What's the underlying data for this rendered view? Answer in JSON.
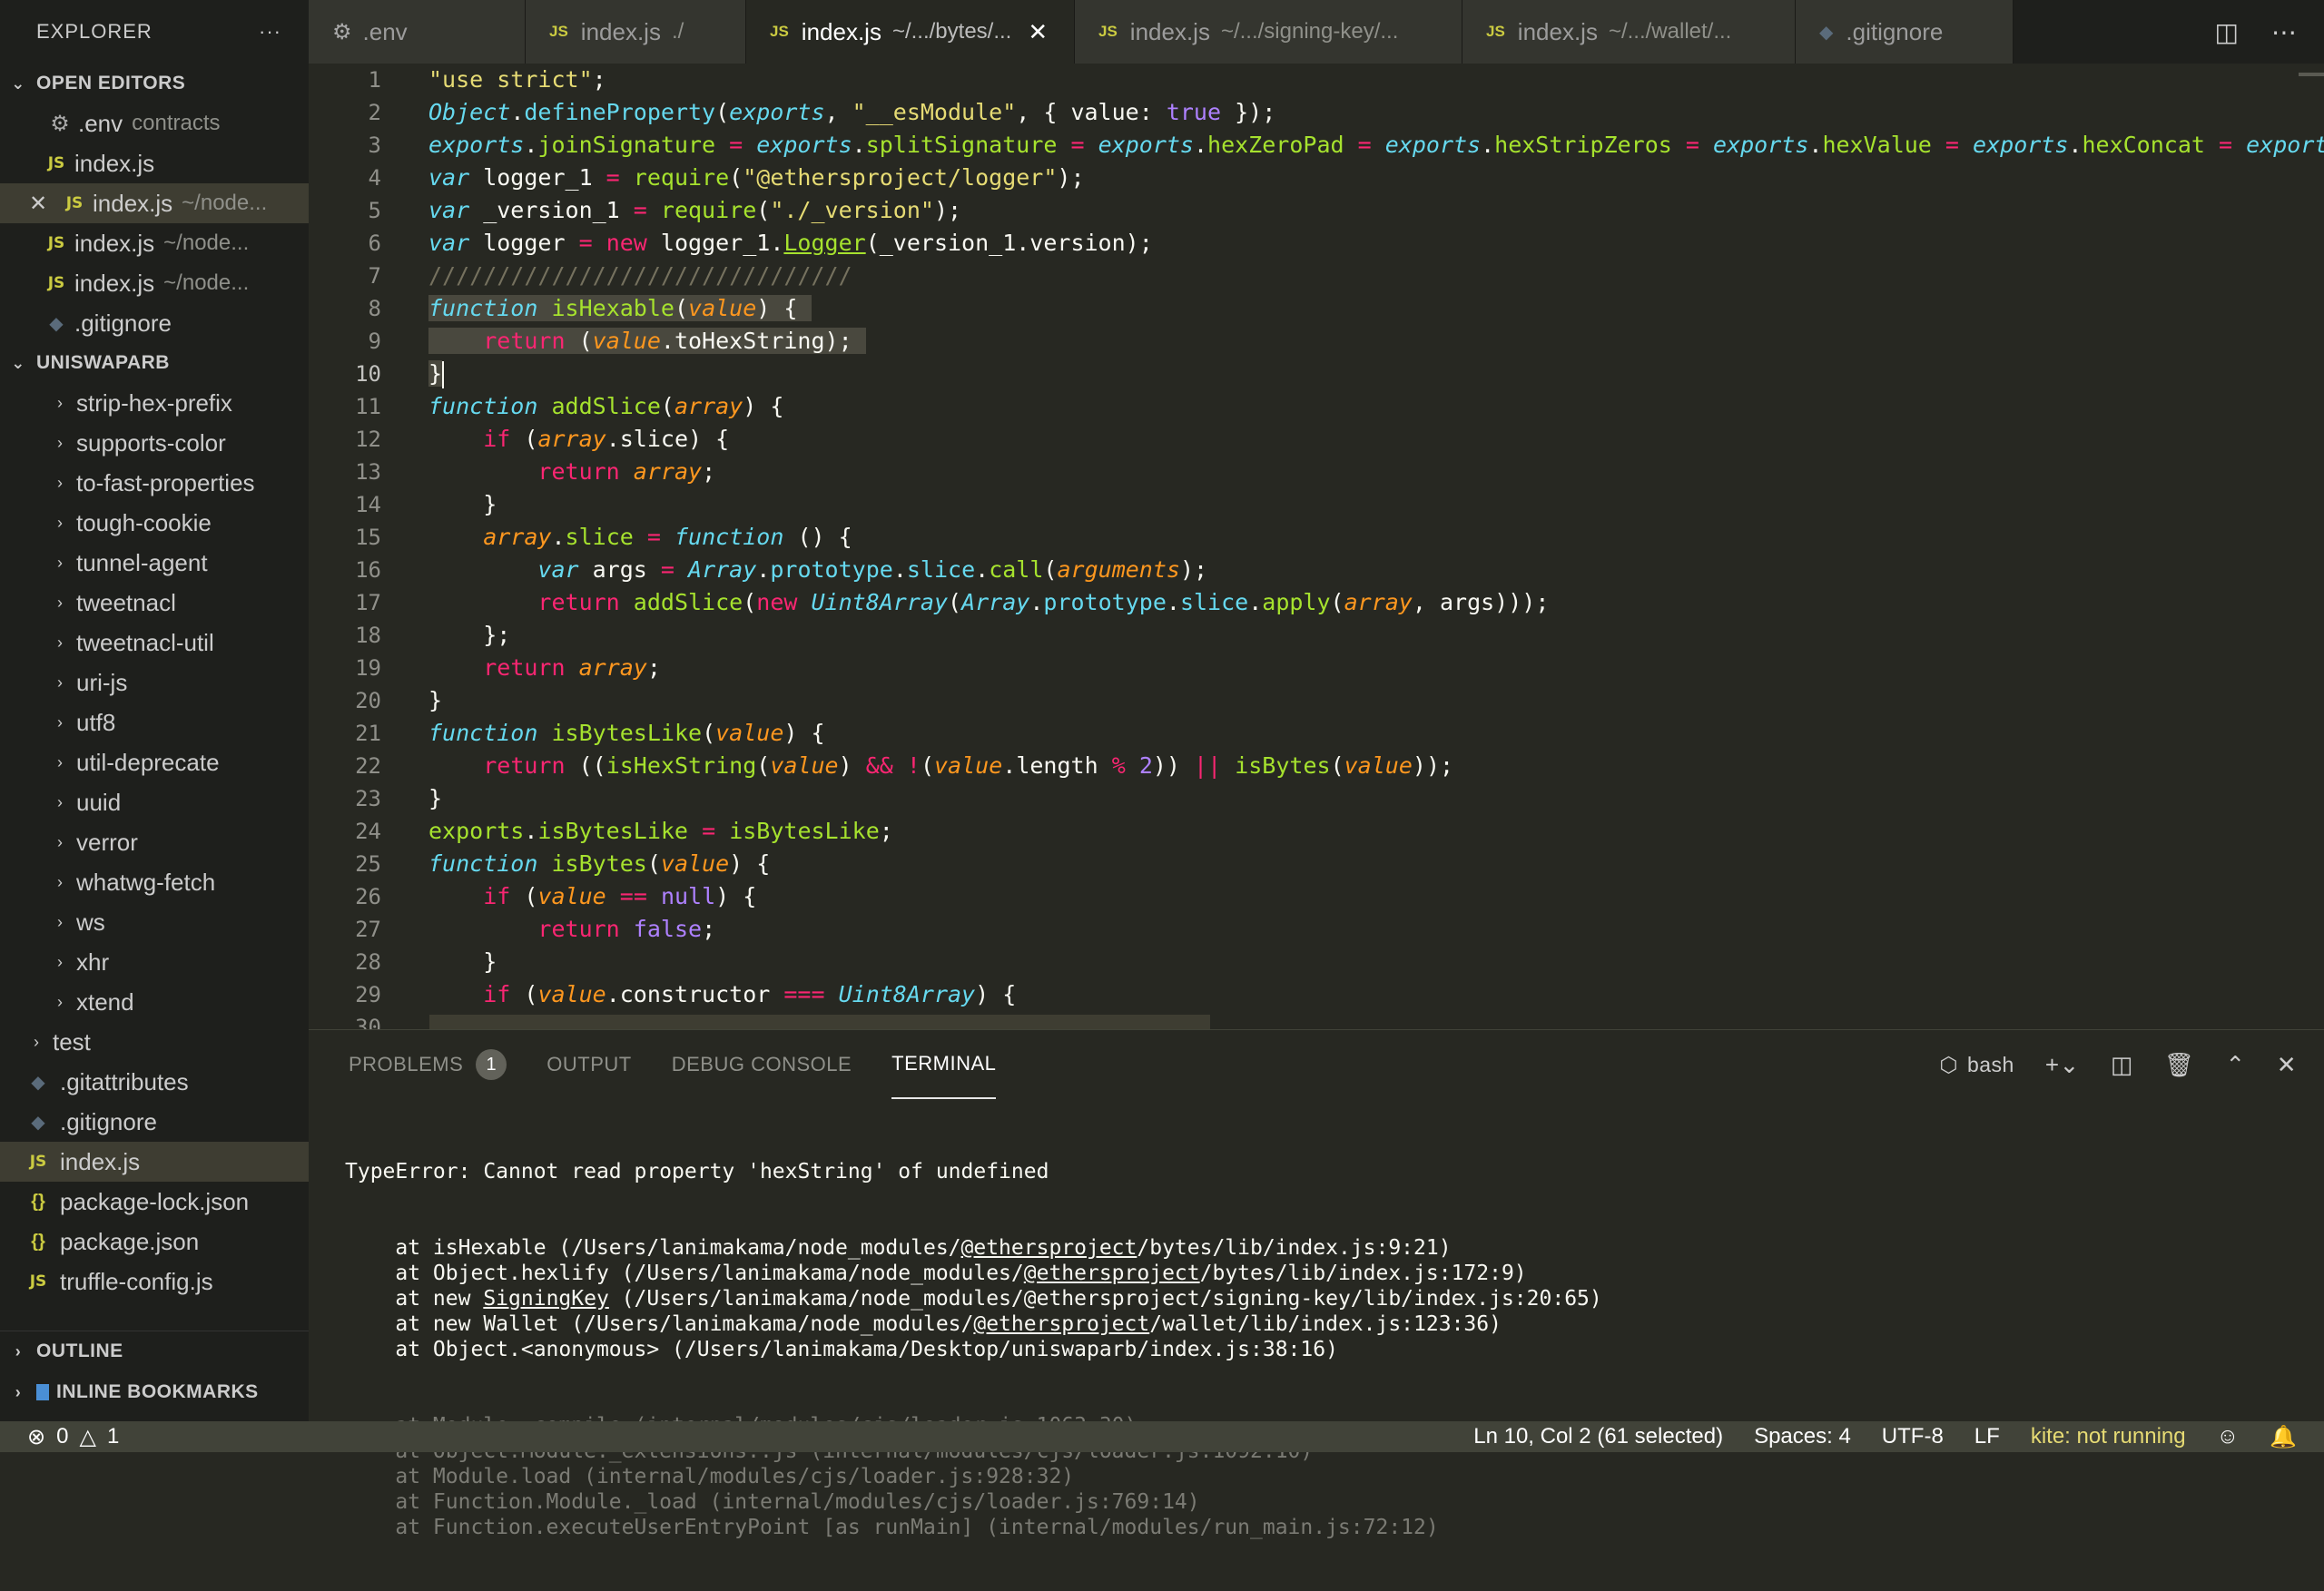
{
  "sidebar": {
    "title": "EXPLORER",
    "more": "···",
    "open_editors_label": "OPEN EDITORS",
    "open_editors": [
      {
        "name": ".env",
        "desc": "contracts",
        "icon": "gear-icon"
      },
      {
        "name": "index.js",
        "desc": "",
        "icon": "js-icon"
      },
      {
        "name": "index.js",
        "desc": "~/node...",
        "icon": "js-icon",
        "active": true
      },
      {
        "name": "index.js",
        "desc": "~/node...",
        "icon": "js-icon"
      },
      {
        "name": "index.js",
        "desc": "~/node...",
        "icon": "js-icon"
      },
      {
        "name": ".gitignore",
        "desc": "",
        "icon": "git-icon"
      }
    ],
    "project_label": "UNISWAPARB",
    "folders": [
      "strip-hex-prefix",
      "supports-color",
      "to-fast-properties",
      "tough-cookie",
      "tunnel-agent",
      "tweetnacl",
      "tweetnacl-util",
      "uri-js",
      "utf8",
      "util-deprecate",
      "uuid",
      "verror",
      "whatwg-fetch",
      "ws",
      "xhr",
      "xtend"
    ],
    "root_items": [
      {
        "name": "test",
        "type": "folder"
      },
      {
        "name": ".gitattributes",
        "type": "git"
      },
      {
        "name": ".gitignore",
        "type": "git"
      },
      {
        "name": "index.js",
        "type": "js",
        "active": true
      },
      {
        "name": "package-lock.json",
        "type": "json"
      },
      {
        "name": "package.json",
        "type": "json"
      },
      {
        "name": "truffle-config.js",
        "type": "js"
      }
    ],
    "outline_label": "OUTLINE",
    "bookmarks_label": "INLINE BOOKMARKS"
  },
  "tabs": [
    {
      "name": ".env",
      "desc": "",
      "icon": "gear"
    },
    {
      "name": "index.js",
      "desc": "./",
      "icon": "js"
    },
    {
      "name": "index.js",
      "desc": "~/.../bytes/...",
      "icon": "js",
      "active": true
    },
    {
      "name": "index.js",
      "desc": "~/.../signing-key/...",
      "icon": "js"
    },
    {
      "name": "index.js",
      "desc": "~/.../wallet/...",
      "icon": "js"
    },
    {
      "name": ".gitignore",
      "desc": "",
      "icon": "git"
    }
  ],
  "editor": {
    "line_numbers": [
      "1",
      "2",
      "3",
      "4",
      "5",
      "6",
      "7",
      "8",
      "9",
      "10",
      "11",
      "12",
      "13",
      "14",
      "15",
      "16",
      "17",
      "18",
      "19",
      "20",
      "21",
      "22",
      "23",
      "24",
      "25",
      "26",
      "27",
      "28",
      "29",
      "30"
    ],
    "current_line": "10"
  },
  "panel": {
    "tabs": [
      "PROBLEMS",
      "OUTPUT",
      "DEBUG CONSOLE",
      "TERMINAL"
    ],
    "problems_count": "1",
    "shell": "bash",
    "terminal": {
      "error": "TypeError: Cannot read property 'hexString' of undefined",
      "trace": [
        {
          "pre": "    at isHexable (/Users/lanimakama/node_modules/",
          "link": "@ethersproject",
          "post": "/bytes/lib/index.js:9:21)"
        },
        {
          "pre": "    at Object.hexlify (/Users/lanimakama/node_modules/",
          "link": "@ethersproject",
          "post": "/bytes/lib/index.js:172:9)"
        },
        {
          "pre": "    at new ",
          "link": "SigningKey",
          "post": " (/Users/lanimakama/node_modules/@ethersproject/signing-key/lib/index.js:20:65)"
        },
        {
          "pre": "    at new Wallet (/Users/lanimakama/node_modules/",
          "link": "@ethersproject",
          "post": "/wallet/lib/index.js:123:36)"
        },
        {
          "pre": "    at Object.<anonymous> (/Users/lanimakama/Desktop/uniswaparb/index.js:38:16)",
          "link": "",
          "post": ""
        }
      ],
      "internal": [
        "    at Module._compile (internal/modules/cjs/loader.js:1063:30)",
        "    at Object.Module._extensions..js (internal/modules/cjs/loader.js:1092:10)",
        "    at Module.load (internal/modules/cjs/loader.js:928:32)",
        "    at Function.Module._load (internal/modules/cjs/loader.js:769:14)",
        "    at Function.executeUserEntryPoint [as runMain] (internal/modules/run_main.js:72:12)"
      ]
    }
  },
  "status": {
    "errors": "0",
    "warnings": "1",
    "position": "Ln 10, Col 2 (61 selected)",
    "spaces": "Spaces: 4",
    "encoding": "UTF-8",
    "eol": "LF",
    "kite": "kite: not running"
  }
}
